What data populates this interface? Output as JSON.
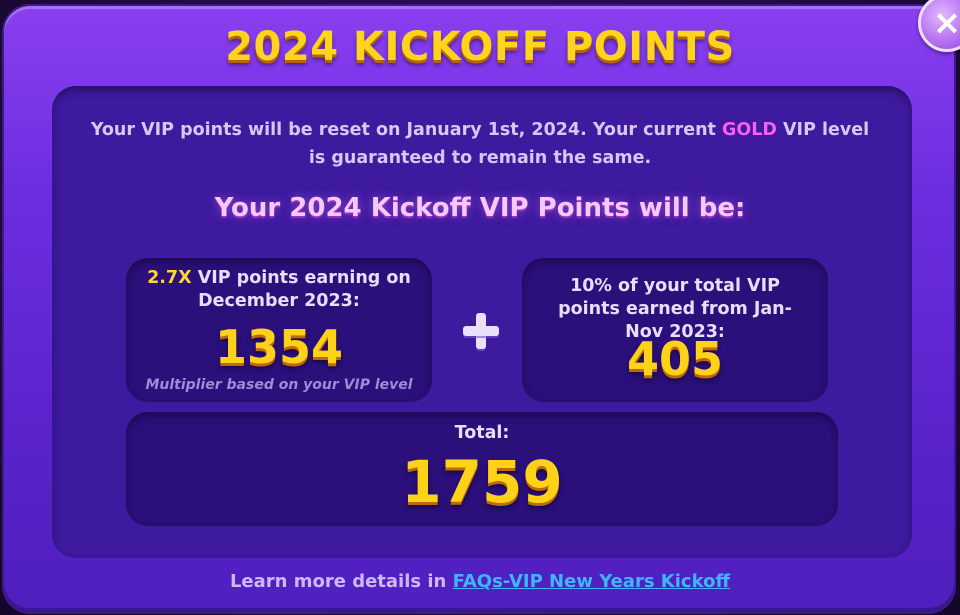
{
  "dialog": {
    "title": "2024 KICKOFF POINTS",
    "close_label": "×"
  },
  "notice": {
    "text_before": "Your VIP points will be reset on January 1st, 2024. Your current ",
    "level": "GOLD",
    "text_after": " VIP level is guaranteed to remain the same."
  },
  "subheading": "Your 2024 Kickoff VIP Points will be:",
  "december": {
    "multiplier": "2.7X",
    "label_rest": " VIP points earning on December 2023:",
    "value": "1354",
    "footnote": "Multiplier based on your VIP level"
  },
  "earlier": {
    "label": "10% of your total VIP points earned from Jan-Nov 2023:",
    "value": "405"
  },
  "total": {
    "label": "Total:",
    "value": "1759"
  },
  "footer": {
    "text": "Learn more details in ",
    "link_text": "FAQs-VIP New Years Kickoff"
  },
  "colors": {
    "title": "#ffd41c",
    "gold_level": "#ff5ff0",
    "link": "#3fb4ff",
    "panel": "#3d1a9e"
  },
  "icons": [
    "close-icon",
    "plus-icon"
  ]
}
